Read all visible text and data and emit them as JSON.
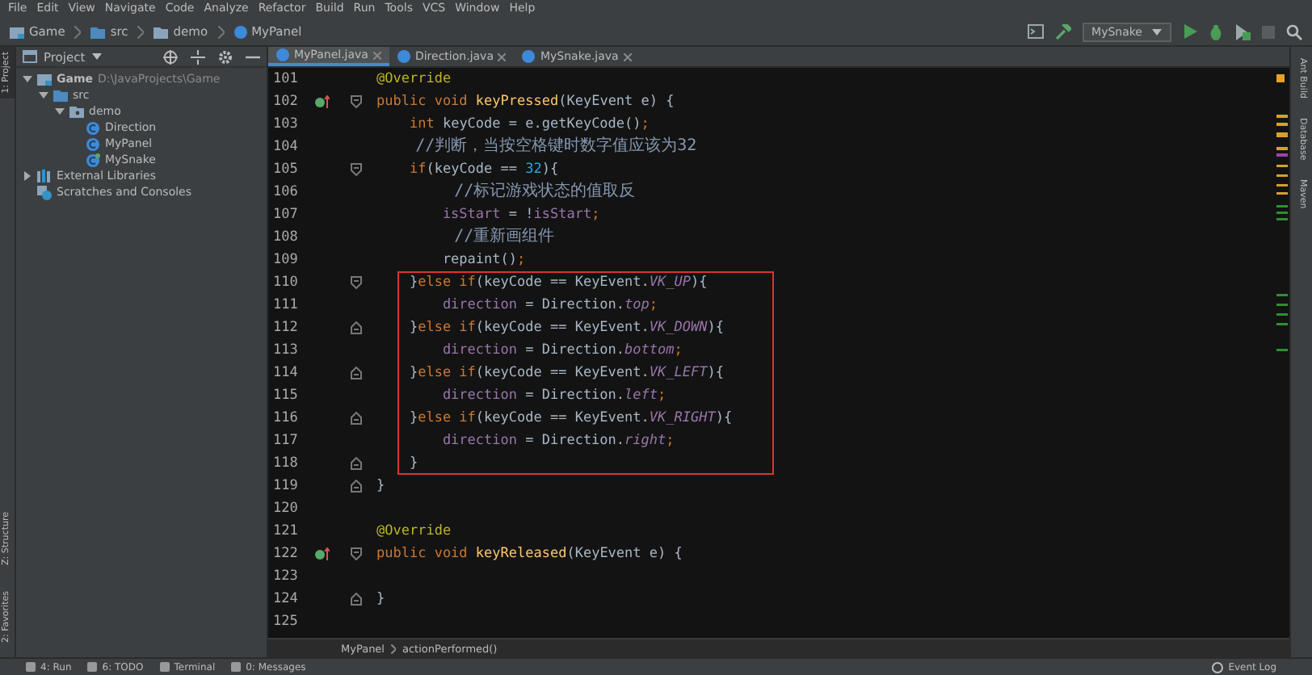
{
  "menu": [
    "File",
    "Edit",
    "View",
    "Navigate",
    "Code",
    "Analyze",
    "Refactor",
    "Build",
    "Run",
    "Tools",
    "VCS",
    "Window",
    "Help"
  ],
  "breadcrumb": [
    {
      "label": "Game",
      "kind": "module"
    },
    {
      "label": "src",
      "kind": "folder"
    },
    {
      "label": "demo",
      "kind": "package"
    },
    {
      "label": "MyPanel",
      "kind": "class"
    }
  ],
  "run_config": "MySnake",
  "left_stripe": {
    "top": [
      {
        "label": "1: Project",
        "selected": true
      }
    ],
    "bottom": [
      {
        "label": "Z: Structure",
        "selected": false
      },
      {
        "label": "2: Favorites",
        "selected": false
      }
    ]
  },
  "project_panel": {
    "title": "Project",
    "tree": [
      {
        "label": "Game",
        "path": "D:\\JavaProjects\\Game",
        "kind": "module",
        "expanded": true,
        "children": [
          {
            "label": "src",
            "kind": "folder",
            "expanded": true,
            "children": [
              {
                "label": "demo",
                "kind": "package",
                "expanded": true,
                "children": [
                  {
                    "label": "Direction",
                    "kind": "class"
                  },
                  {
                    "label": "MyPanel",
                    "kind": "class"
                  },
                  {
                    "label": "MySnake",
                    "kind": "main-class"
                  }
                ]
              }
            ]
          }
        ]
      },
      {
        "label": "External Libraries",
        "kind": "library",
        "expanded": false
      },
      {
        "label": "Scratches and Consoles",
        "kind": "scratch"
      }
    ]
  },
  "tabs": [
    {
      "label": "MyPanel.java",
      "selected": true
    },
    {
      "label": "Direction.java",
      "selected": false
    },
    {
      "label": "MySnake.java",
      "selected": false
    }
  ],
  "blocks": [
    {
      "boxed": false,
      "lines": [
        {
          "number": "101",
          "kind": "line",
          "tokens": [
            {
              "kind": "annotation",
              "text": "@Override"
            }
          ]
        },
        {
          "number": "102",
          "kind": "fold-start",
          "override": true,
          "tokens": [
            {
              "kind": "keyword",
              "text": "public void "
            },
            {
              "kind": "method",
              "text": "keyPressed"
            },
            {
              "kind": "plain",
              "text": "(KeyEvent e) {"
            }
          ]
        },
        {
          "number": "103",
          "kind": "line",
          "tokens": [
            {
              "kind": "keyword",
              "text": "    int "
            },
            {
              "kind": "plain",
              "text": "keyCode = e.getKeyCode()"
            },
            {
              "kind": "keyword",
              "text": ";"
            }
          ]
        },
        {
          "number": "104",
          "kind": "line",
          "tokens": [
            {
              "kind": "comment",
              "text": "    //判断，当按空格键时数字值应该为32"
            }
          ]
        },
        {
          "number": "105",
          "kind": "fold-start",
          "tokens": [
            {
              "kind": "keyword",
              "text": "    if"
            },
            {
              "kind": "plain",
              "text": "(keyCode == "
            },
            {
              "kind": "number",
              "text": "32"
            },
            {
              "kind": "plain",
              "text": "){"
            }
          ]
        },
        {
          "number": "106",
          "kind": "line",
          "tokens": [
            {
              "kind": "comment",
              "text": "        //标记游戏状态的值取反"
            }
          ]
        },
        {
          "number": "107",
          "kind": "line",
          "tokens": [
            {
              "kind": "field",
              "text": "        isStart"
            },
            {
              "kind": "plain",
              "text": " = !"
            },
            {
              "kind": "field",
              "text": "isStart"
            },
            {
              "kind": "keyword",
              "text": ";"
            }
          ]
        },
        {
          "number": "108",
          "kind": "line",
          "tokens": [
            {
              "kind": "comment",
              "text": "        //重新画组件"
            }
          ]
        },
        {
          "number": "109",
          "kind": "line",
          "tokens": [
            {
              "kind": "plain",
              "text": "        repaint()"
            },
            {
              "kind": "keyword",
              "text": ";"
            }
          ]
        }
      ]
    },
    {
      "boxed": true,
      "lines": [
        {
          "number": "110",
          "kind": "fold-start",
          "tokens": [
            {
              "kind": "plain",
              "text": "    }"
            },
            {
              "kind": "keyword",
              "text": "else if"
            },
            {
              "kind": "plain",
              "text": "(keyCode == KeyEvent."
            },
            {
              "kind": "static",
              "text": "VK_UP"
            },
            {
              "kind": "plain",
              "text": "){"
            }
          ]
        },
        {
          "number": "111",
          "kind": "line",
          "tokens": [
            {
              "kind": "field",
              "text": "        direction"
            },
            {
              "kind": "plain",
              "text": " = Direction."
            },
            {
              "kind": "static",
              "text": "top"
            },
            {
              "kind": "keyword",
              "text": ";"
            }
          ]
        },
        {
          "number": "112",
          "kind": "fold-end",
          "tokens": [
            {
              "kind": "plain",
              "text": "    }"
            },
            {
              "kind": "keyword",
              "text": "else if"
            },
            {
              "kind": "plain",
              "text": "(keyCode == KeyEvent."
            },
            {
              "kind": "static",
              "text": "VK_DOWN"
            },
            {
              "kind": "plain",
              "text": "){"
            }
          ]
        },
        {
          "number": "113",
          "kind": "line",
          "tokens": [
            {
              "kind": "field",
              "text": "        direction"
            },
            {
              "kind": "plain",
              "text": " = Direction."
            },
            {
              "kind": "static",
              "text": "bottom"
            },
            {
              "kind": "keyword",
              "text": ";"
            }
          ]
        },
        {
          "number": "114",
          "kind": "fold-end",
          "tokens": [
            {
              "kind": "plain",
              "text": "    }"
            },
            {
              "kind": "keyword",
              "text": "else if"
            },
            {
              "kind": "plain",
              "text": "(keyCode == KeyEvent."
            },
            {
              "kind": "static",
              "text": "VK_LEFT"
            },
            {
              "kind": "plain",
              "text": "){"
            }
          ]
        },
        {
          "number": "115",
          "kind": "line",
          "tokens": [
            {
              "kind": "field",
              "text": "        direction"
            },
            {
              "kind": "plain",
              "text": " = Direction."
            },
            {
              "kind": "static",
              "text": "left"
            },
            {
              "kind": "keyword",
              "text": ";"
            }
          ]
        },
        {
          "number": "116",
          "kind": "fold-end",
          "tokens": [
            {
              "kind": "plain",
              "text": "    }"
            },
            {
              "kind": "keyword",
              "text": "else if"
            },
            {
              "kind": "plain",
              "text": "(keyCode == KeyEvent."
            },
            {
              "kind": "static",
              "text": "VK_RIGHT"
            },
            {
              "kind": "plain",
              "text": "){"
            }
          ]
        },
        {
          "number": "117",
          "kind": "line",
          "tokens": [
            {
              "kind": "field",
              "text": "        direction"
            },
            {
              "kind": "plain",
              "text": " = Direction."
            },
            {
              "kind": "static",
              "text": "right"
            },
            {
              "kind": "keyword",
              "text": ";"
            }
          ]
        },
        {
          "number": "118",
          "kind": "fold-end",
          "tokens": [
            {
              "kind": "plain",
              "text": "    }"
            }
          ]
        }
      ]
    },
    {
      "boxed": false,
      "lines": [
        {
          "number": "119",
          "kind": "fold-end",
          "tokens": [
            {
              "kind": "plain",
              "text": "}"
            }
          ]
        },
        {
          "number": "120",
          "kind": "line"
        },
        {
          "number": "121",
          "kind": "line",
          "tokens": [
            {
              "kind": "annotation",
              "text": "@Override"
            }
          ]
        },
        {
          "number": "122",
          "kind": "fold-start",
          "override": true,
          "tokens": [
            {
              "kind": "keyword",
              "text": "public void "
            },
            {
              "kind": "method",
              "text": "keyReleased"
            },
            {
              "kind": "plain",
              "text": "(KeyEvent e) {"
            }
          ]
        },
        {
          "number": "123",
          "kind": "line"
        },
        {
          "number": "124",
          "kind": "fold-end",
          "tokens": [
            {
              "kind": "plain",
              "text": "}"
            }
          ]
        },
        {
          "number": "125",
          "kind": "line"
        }
      ]
    }
  ],
  "editor_breadcrumb": [
    "MyPanel",
    "actionPerformed()"
  ],
  "right_stripe": [
    {
      "label": "Ant Build",
      "selected": false
    },
    {
      "label": "Database",
      "selected": false
    },
    {
      "label": "Maven",
      "selected": false
    }
  ],
  "bottom_bar": {
    "left": [
      "4: Run",
      "6: TODO",
      "Terminal",
      "0: Messages"
    ],
    "right": "Event Log"
  }
}
